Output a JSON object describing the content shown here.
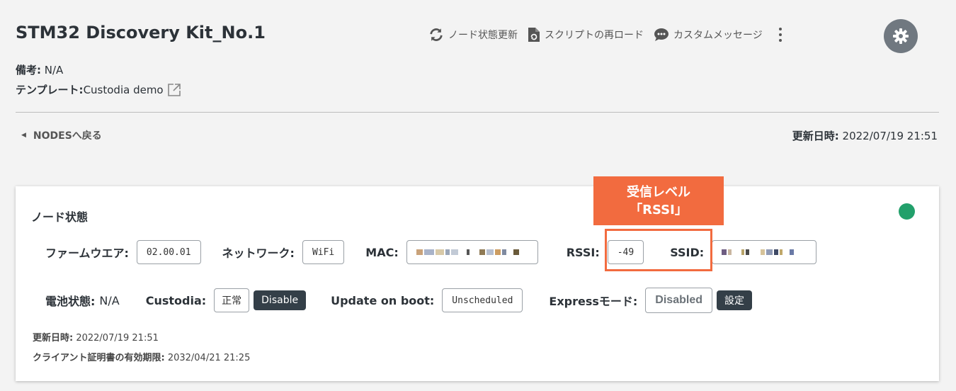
{
  "header": {
    "title": "STM32 Discovery Kit_No.1",
    "actions": {
      "refresh_label": "ノード状態更新",
      "reload_script_label": "スクリプトの再ロード",
      "custom_message_label": "カスタムメッセージ"
    },
    "remark_label": "備考:",
    "remark_value": " N/A",
    "template_label": "テンプレート:",
    "template_value": " Custodia demo"
  },
  "nav": {
    "back_label": "NODESへ戻る",
    "updated_label": "更新日時:",
    "updated_value": " 2022/07/19 21:51"
  },
  "card": {
    "title": "ノード状態",
    "status_color": "#22a06b",
    "firmware_label": "ファームウエア:",
    "firmware_value": "02.00.01",
    "network_label": "ネットワーク:",
    "network_value": "WiFi",
    "mac_label": "MAC:",
    "rssi_label": "RSSI:",
    "rssi_value": "-49",
    "ssid_label": "SSID:",
    "battery_label": "電池状態:",
    "battery_value": "N/A",
    "custodia_label": "Custodia:",
    "custodia_status": "正常",
    "custodia_button": "Disable",
    "update_on_boot_label": "Update on boot:",
    "update_on_boot_value": "Unscheduled",
    "express_label": "Expressモード:",
    "express_value": "Disabled",
    "express_button": "設定",
    "updated_label": "更新日時:",
    "updated_value": " 2022/07/19 21:51",
    "cert_label": "クライアント証明書の有効期限:",
    "cert_value": " 2032/04/21 21:25"
  },
  "annotation": {
    "line1": "受信レベル",
    "line2": "「RSSI」",
    "color": "#f26b3f"
  }
}
